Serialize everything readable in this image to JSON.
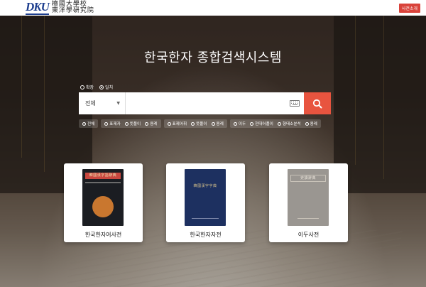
{
  "header": {
    "logo_mark": "DKU",
    "org_line1": "檀國大學校",
    "org_line2": "東洋學硏究院",
    "intro_button": "사전소개"
  },
  "main": {
    "title": "한국한자 종합검색시스템",
    "search_type": [
      {
        "label": "확장",
        "selected": false
      },
      {
        "label": "일치",
        "selected": true
      }
    ],
    "search": {
      "scope_value": "전체",
      "placeholder": "",
      "keyboard_icon": "keyboard-icon",
      "submit_icon": "search-icon"
    },
    "filters": [
      {
        "items": [
          {
            "label": "전체",
            "selected": true
          }
        ]
      },
      {
        "items": [
          {
            "label": "표제자",
            "selected": false
          },
          {
            "label": "뜻풀이",
            "selected": false
          },
          {
            "label": "용례",
            "selected": false
          }
        ]
      },
      {
        "items": [
          {
            "label": "표제어휘",
            "selected": false
          },
          {
            "label": "뜻풀이",
            "selected": false
          },
          {
            "label": "용례",
            "selected": false
          }
        ]
      },
      {
        "items": [
          {
            "label": "이두",
            "selected": false
          },
          {
            "label": "현대어풀이",
            "selected": false
          },
          {
            "label": "형태소분석",
            "selected": false
          },
          {
            "label": "용례",
            "selected": false
          }
        ]
      }
    ],
    "dictionaries": [
      {
        "label": "한국한자어사전",
        "cover_title": "韓國漢字語辭典"
      },
      {
        "label": "한국한자자전",
        "cover_title": "韓國漢字字典"
      },
      {
        "label": "이두사전",
        "cover_title": "吏讀辭典"
      }
    ]
  },
  "colors": {
    "accent": "#e8543f",
    "brand": "#1e3f8f",
    "intro_button": "#d9433b"
  }
}
